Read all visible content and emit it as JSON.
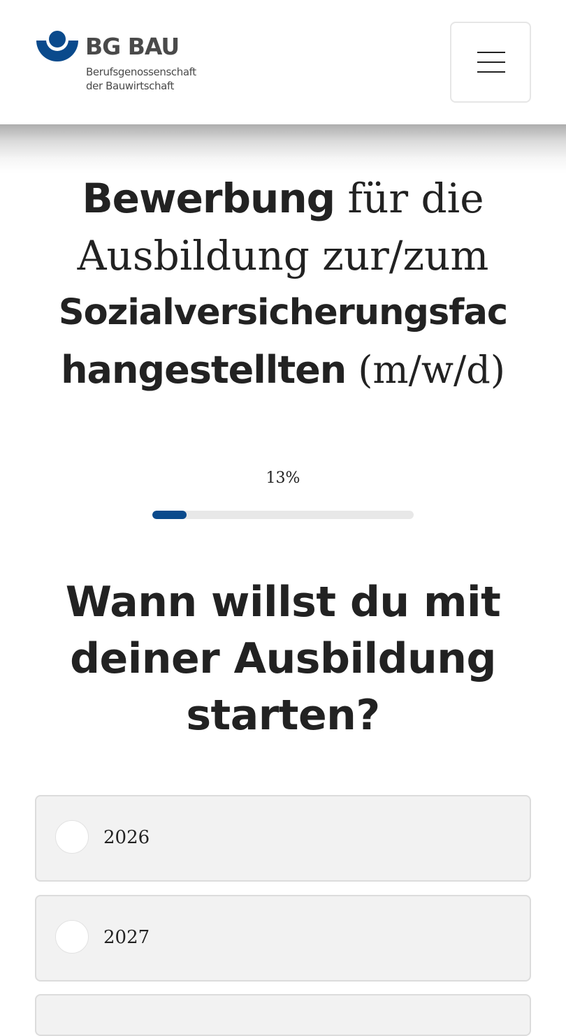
{
  "header": {
    "logo": {
      "title": "BG BAU",
      "subtitle_line1": "Berufsgenossenschaft",
      "subtitle_line2": "der Bauwirtschaft",
      "emblem_icon": "bg-bau-emblem-icon",
      "brand_color": "#0a4a8c"
    },
    "menu_icon": "hamburger-menu-icon"
  },
  "page_title": {
    "line1_bold": "Bewerbung",
    "line1_regular": " für die",
    "line2_regular": "Ausbildung zur/zum",
    "line3_bold": "Sozialversicherungsfac",
    "line4_bold": "hangestellten",
    "line4_regular": " (m/w/d)"
  },
  "progress": {
    "label": "13%",
    "value": 0.13,
    "fill_color": "#0a4a8c",
    "track_color": "#e8e8e8"
  },
  "question": {
    "line1": "Wann willst du mit",
    "line2": "deiner Ausbildung",
    "line3": "starten?"
  },
  "options": [
    {
      "label": "2026",
      "selected": false
    },
    {
      "label": "2027",
      "selected": false
    },
    {
      "label": "",
      "selected": false
    }
  ]
}
